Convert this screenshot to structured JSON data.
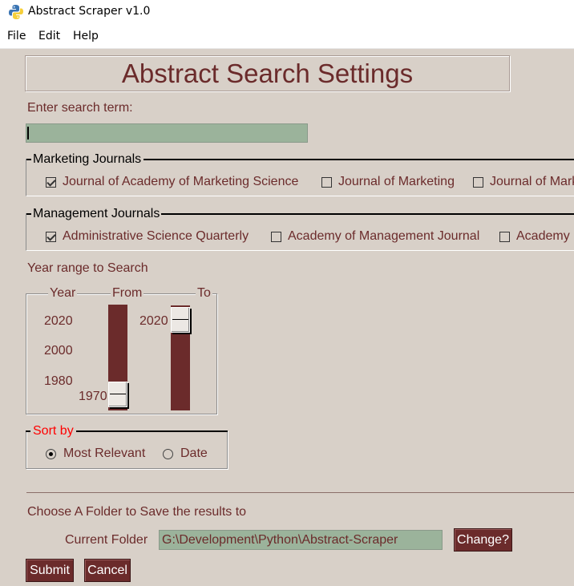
{
  "window": {
    "title": "Abstract Scraper v1.0"
  },
  "menu": {
    "items": [
      "File",
      "Edit",
      "Help"
    ]
  },
  "header": {
    "title": "Abstract Search Settings"
  },
  "search": {
    "label": "Enter search term:",
    "value": ""
  },
  "marketing": {
    "title": "Marketing Journals",
    "items": [
      {
        "label": "Journal of Academy of Marketing Science",
        "checked": true
      },
      {
        "label": "Journal of Marketing",
        "checked": false
      },
      {
        "label": "Journal of Mark",
        "checked": false
      }
    ]
  },
  "management": {
    "title": "Management Journals",
    "items": [
      {
        "label": "Administrative Science Quarterly",
        "checked": true
      },
      {
        "label": "Academy of Management Journal",
        "checked": false
      },
      {
        "label": "Academy",
        "checked": false
      }
    ]
  },
  "year_range": {
    "label": "Year range to Search",
    "col_year": "Year",
    "col_from": "From",
    "col_to": "To",
    "scale": [
      "2020",
      "2000",
      "1980"
    ],
    "from_value": "1970",
    "to_value": "2020"
  },
  "sort": {
    "title": "Sort by",
    "title_color": "#ff0000",
    "options": [
      {
        "label": "Most Relevant",
        "selected": true
      },
      {
        "label": "Date",
        "selected": false
      }
    ]
  },
  "folder": {
    "label": "Choose A Folder to Save the results to",
    "current_label": "Current Folder",
    "current_value": "G:\\Development\\Python\\Abstract-Scraper",
    "change_button": "Change?"
  },
  "actions": {
    "submit": "Submit",
    "cancel": "Cancel"
  },
  "colors": {
    "accent": "#6b2b2b",
    "field": "#9bb39b",
    "background": "#d8d0c8"
  }
}
